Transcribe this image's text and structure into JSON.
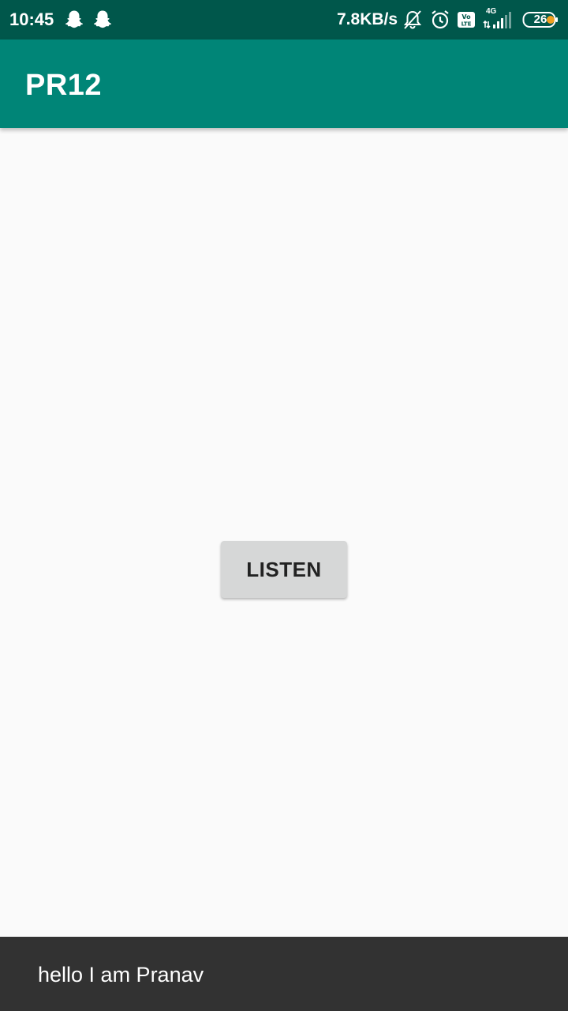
{
  "status_bar": {
    "time": "10:45",
    "net_speed": "7.8KB/s",
    "network_type": "4G",
    "battery_level": "26",
    "icons": [
      "snapchat-ghost-icon",
      "snapchat-ghost-icon",
      "bell-off-icon",
      "alarm-clock-icon",
      "volte-icon",
      "signal-icon",
      "battery-icon"
    ],
    "background_color": "#00574b"
  },
  "app_bar": {
    "title": "PR12",
    "background_color": "#008577"
  },
  "main": {
    "listen_button_label": "LISTEN"
  },
  "snackbar": {
    "message": "hello I am Pranav"
  }
}
